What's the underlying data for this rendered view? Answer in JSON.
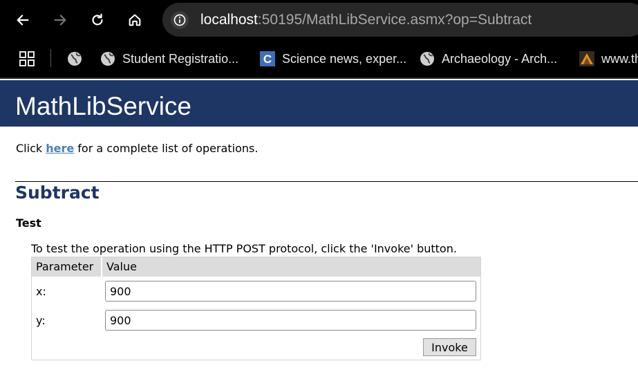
{
  "browser": {
    "url_host": "localhost",
    "url_rest": ":50195/MathLibService.asmx?op=Subtract",
    "bookmarks": [
      {
        "label": "Student Registratio...",
        "icon": "globe-icon"
      },
      {
        "label": "Science news, exper...",
        "icon": "c-logo-icon"
      },
      {
        "label": "Archaeology - Arch...",
        "icon": "globe-icon"
      },
      {
        "label": "www.th",
        "icon": "triangle-logo-icon"
      }
    ]
  },
  "page": {
    "service_name": "MathLibService",
    "intro_prefix": "Click ",
    "intro_link": "here",
    "intro_suffix": " for a complete list of operations.",
    "operation": "Subtract",
    "test_heading": "Test",
    "instructions": "To test the operation using the HTTP POST protocol, click the 'Invoke' button.",
    "table": {
      "col_parameter": "Parameter",
      "col_value": "Value",
      "rows": [
        {
          "label": "x:",
          "value": "900"
        },
        {
          "label": "y:",
          "value": "900"
        }
      ]
    },
    "invoke_label": "Invoke"
  },
  "colors": {
    "banner": "#1e3664",
    "heading": "#1e3664",
    "link": "#4a7fb8"
  }
}
